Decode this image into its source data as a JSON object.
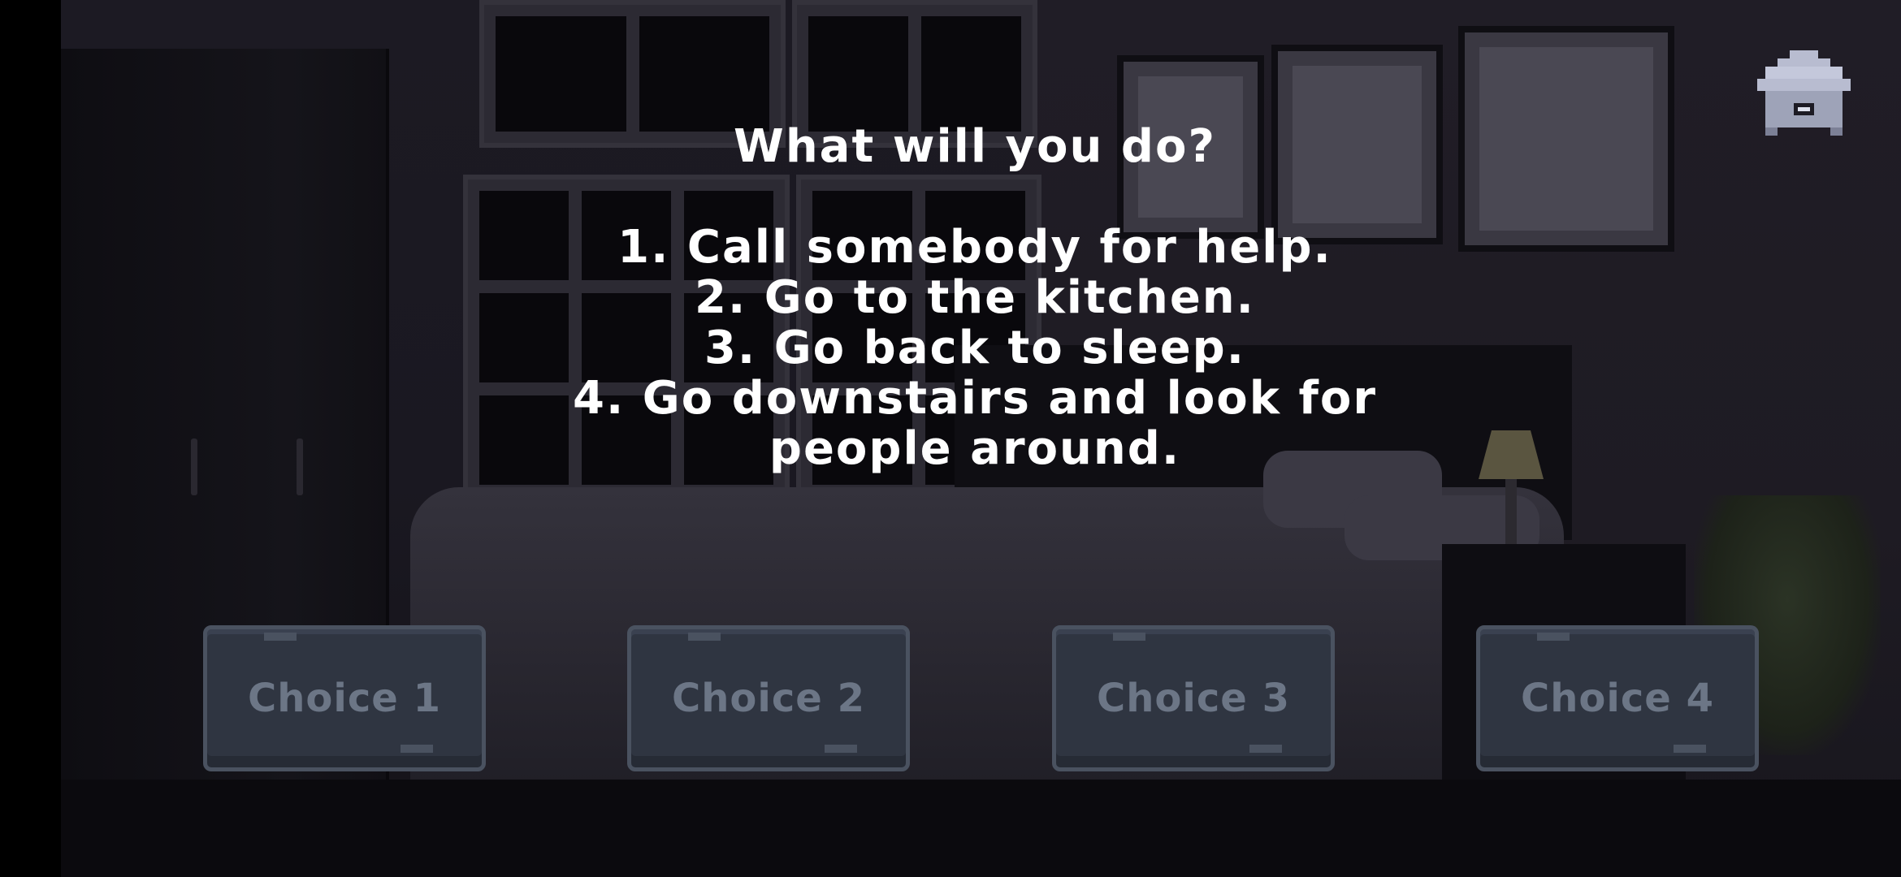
{
  "prompt": {
    "question": "What will you do?",
    "options": [
      "1. Call somebody for help.",
      "2. Go to the kitchen.",
      "3. Go back to sleep.",
      "4. Go downstairs and look for",
      "people around."
    ]
  },
  "home": {
    "icon": "home-icon",
    "color": "#b8bcd0"
  },
  "choices": [
    {
      "label": "Choice 1"
    },
    {
      "label": "Choice 2"
    },
    {
      "label": "Choice 3"
    },
    {
      "label": "Choice 4"
    }
  ],
  "colors": {
    "prompt_text": "#ffffff",
    "button_fill": "#2f3541",
    "button_border": "#4a5260",
    "button_text": "#6c7686"
  }
}
